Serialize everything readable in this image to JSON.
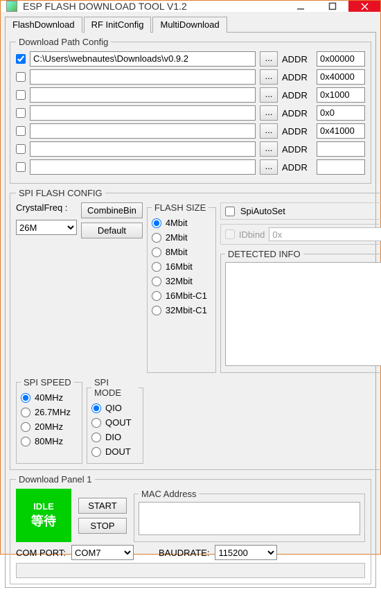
{
  "window": {
    "title": "ESP FLASH DOWNLOAD TOOL V1.2"
  },
  "tabs": {
    "t0": "FlashDownload",
    "t1": "RF InitConfig",
    "t2": "MultiDownload"
  },
  "pathcfg": {
    "legend": "Download Path Config",
    "browse": "...",
    "addr": "ADDR",
    "rows": [
      {
        "checked": true,
        "path": "C:\\Users\\webnautes\\Downloads\\v0.9.2",
        "address": "0x00000"
      },
      {
        "checked": false,
        "path": "",
        "address": "0x40000"
      },
      {
        "checked": false,
        "path": "",
        "address": "0x1000"
      },
      {
        "checked": false,
        "path": "",
        "address": "0x0"
      },
      {
        "checked": false,
        "path": "",
        "address": "0x41000"
      },
      {
        "checked": false,
        "path": "",
        "address": ""
      },
      {
        "checked": false,
        "path": "",
        "address": ""
      }
    ]
  },
  "spi": {
    "legend": "SPI FLASH CONFIG",
    "crystal_label": "CrystalFreq :",
    "crystal_value": "26M",
    "combine": "CombineBin",
    "default": "Default",
    "speed": {
      "legend": "SPI SPEED",
      "o0": "40MHz",
      "o1": "26.7MHz",
      "o2": "20MHz",
      "o3": "80MHz"
    },
    "mode": {
      "legend": "SPI MODE",
      "o0": "QIO",
      "o1": "QOUT",
      "o2": "DIO",
      "o3": "DOUT"
    },
    "size": {
      "legend": "FLASH SIZE",
      "o0": "4Mbit",
      "o1": "2Mbit",
      "o2": "8Mbit",
      "o3": "16Mbit",
      "o4": "32Mbit",
      "o5": "16Mbit-C1",
      "o6": "32Mbit-C1"
    },
    "spiauto": "SpiAutoSet",
    "idbind_label": "IDbind",
    "idbind_value": "0x",
    "detected_legend": "DETECTED INFO"
  },
  "dlpanel": {
    "legend": "Download Panel 1",
    "idle": "IDLE",
    "idle_cn": "等待",
    "start": "START",
    "stop": "STOP",
    "mac_legend": "MAC Address",
    "comport_label": "COM PORT:",
    "comport_value": "COM7",
    "baud_label": "BAUDRATE:",
    "baud_value": "115200"
  }
}
